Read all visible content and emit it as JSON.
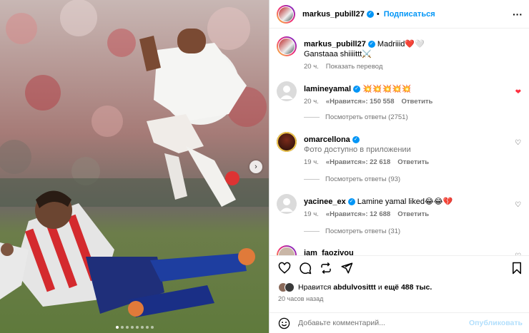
{
  "post": {
    "author": "markus_pubill27",
    "follow_label": "Подписаться",
    "more_icon": "ellipsis-icon",
    "photo": {
      "dot_count": 8,
      "active_dot": 0
    }
  },
  "caption": {
    "username": "markus_pubill27",
    "line1": "Madriiid❤️🤍",
    "line2": "Ganstaaa shiiiittt⚔️",
    "time": "20 ч.",
    "translate_label": "Показать перевод"
  },
  "comments": [
    {
      "username": "lamineyamal",
      "text": "💥💥💥💥💥",
      "time": "20 ч.",
      "likes": "«Нравится»: 150 558",
      "reply_label": "Ответить",
      "liked": true,
      "replies_label": "Посмотреть ответы (2751)"
    },
    {
      "username": "omarcellona",
      "text": "Фото доступно в приложении",
      "time": "19 ч.",
      "likes": "«Нравится»: 22 618",
      "reply_label": "Ответить",
      "liked": false,
      "replies_label": "Посмотреть ответы (93)"
    },
    {
      "username": "yacinee_ex",
      "text": "Lamine yamal liked😂😂💔",
      "time": "19 ч.",
      "likes": "«Нравится»: 12 688",
      "reply_label": "Ответить",
      "liked": false,
      "replies_label": "Посмотреть ответы (31)"
    },
    {
      "username": "iam_faozivou",
      "text": "",
      "time": "",
      "likes": "",
      "reply_label": "",
      "liked": false,
      "replies_label": ""
    }
  ],
  "likes": {
    "prefix": "Нравится",
    "user": "abdulvosittt",
    "joiner": "и",
    "more": "ещё 488 тыс."
  },
  "posted_ago": "20 часов назад",
  "add_comment": {
    "placeholder": "Добавьте комментарий...",
    "publish_label": "Опубликовать"
  },
  "colors": {
    "accent": "#0095f6",
    "like_red": "#ff3040",
    "muted": "#737373"
  }
}
